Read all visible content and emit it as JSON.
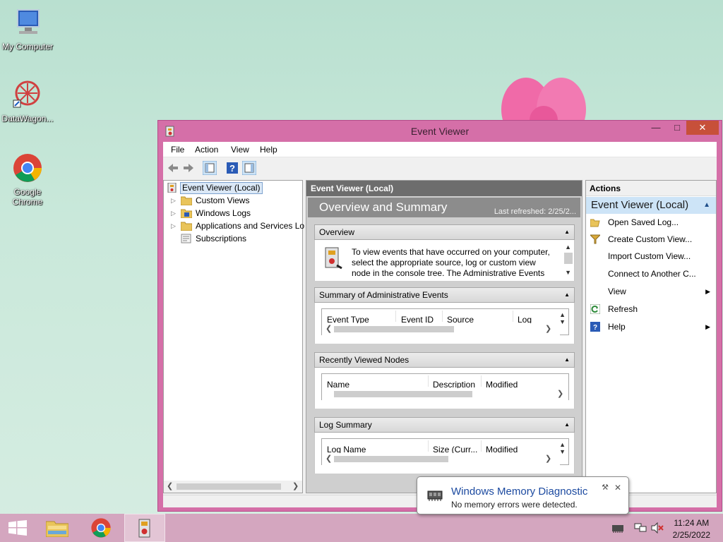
{
  "desktop": {
    "icons": [
      {
        "label": "My Computer"
      },
      {
        "label": "DataWagon..."
      },
      {
        "label": "Google Chrome"
      }
    ]
  },
  "window": {
    "title": "Event Viewer",
    "menu": [
      "File",
      "Action",
      "View",
      "Help"
    ]
  },
  "tree": {
    "items": [
      {
        "label": "Event Viewer (Local)"
      },
      {
        "label": "Custom Views"
      },
      {
        "label": "Windows Logs"
      },
      {
        "label": "Applications and Services Lo"
      },
      {
        "label": "Subscriptions"
      }
    ]
  },
  "center": {
    "header": "Event Viewer (Local)",
    "banner_title": "Overview and Summary",
    "last_refreshed": "Last refreshed: 2/25/2...",
    "overview": {
      "title": "Overview",
      "text_lines": [
        "To view events that have occurred on your computer,",
        "select the appropriate source, log or custom view",
        "node in the console tree. The Administrative Events"
      ]
    },
    "admin_events": {
      "title": "Summary of Administrative Events",
      "columns": [
        "Event Type",
        "Event ID",
        "Source",
        "Log"
      ]
    },
    "recent_nodes": {
      "title": "Recently Viewed Nodes",
      "columns": [
        "Name",
        "Description",
        "Modified"
      ]
    },
    "log_summary": {
      "title": "Log Summary",
      "columns": [
        "Log Name",
        "Size (Curr...",
        "Modified"
      ]
    }
  },
  "actions": {
    "header": "Actions",
    "subheader": "Event Viewer (Local)",
    "items": [
      {
        "label": "Open Saved Log...",
        "icon": "folder-open-icon"
      },
      {
        "label": "Create Custom View...",
        "icon": "filter-icon"
      },
      {
        "label": "Import Custom View...",
        "icon": ""
      },
      {
        "label": "Connect to Another C...",
        "icon": ""
      },
      {
        "label": "View",
        "icon": ""
      },
      {
        "label": "Refresh",
        "icon": "refresh-icon"
      },
      {
        "label": "Help",
        "icon": "help-icon"
      }
    ]
  },
  "notification": {
    "title": "Windows Memory Diagnostic",
    "message": "No memory errors were detected."
  },
  "taskbar": {
    "time": "11:24 AM",
    "date": "2/25/2022"
  },
  "colors": {
    "window_frame": "#d56fa8",
    "taskbar": "#d4a6bf",
    "actions_highlight": "#cde4f7"
  }
}
